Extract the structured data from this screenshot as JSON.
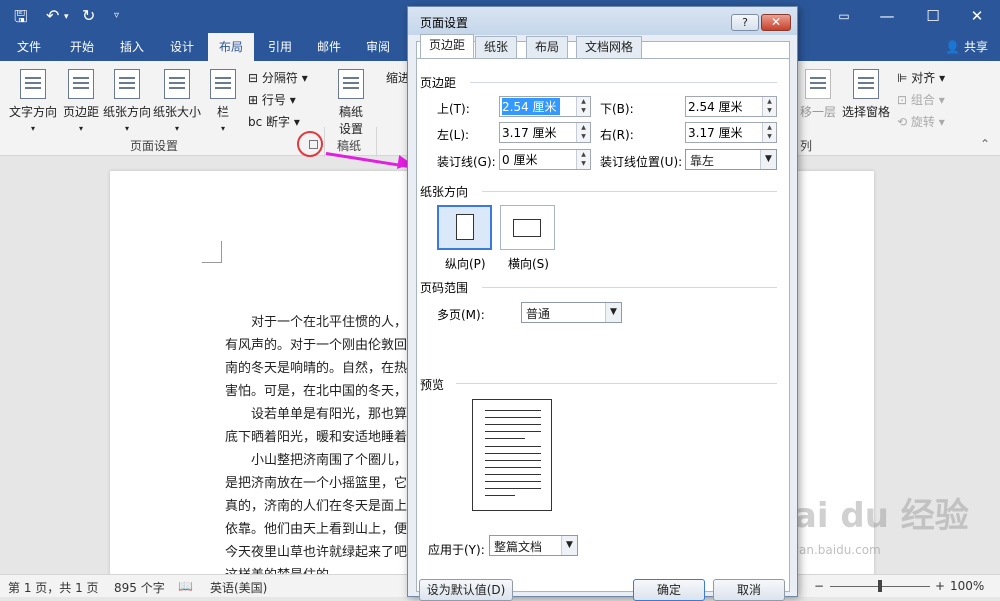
{
  "titlebar": {
    "save_icon": "save-icon",
    "undo_icon": "undo-icon",
    "redo_icon": "redo-icon",
    "customize_icon": "chevron-down-icon",
    "ribbon_display_icon": "ribbon-display-icon",
    "minimize": "—",
    "maximize": "☐",
    "close": "✕",
    "bg_color": "#2b579a"
  },
  "ribbon_tabs": [
    "文件",
    "开始",
    "插入",
    "设计",
    "布局",
    "引用",
    "邮件",
    "审阅"
  ],
  "ribbon_active_tab": "布局",
  "share_label": "共享",
  "ribbon": {
    "text_direction": "文字方向",
    "margins": "页边距",
    "orientation": "纸张方向",
    "size": "纸张大小",
    "columns": "栏",
    "breaks": "分隔符",
    "line_numbers": "行号",
    "hyphenation": "断字",
    "page_setup_group": "页面设置",
    "draft_paper": "稿纸\n设置",
    "draft_line1": "稿纸",
    "draft_line2": "设置",
    "draft_group": "稿纸",
    "indent": "缩进",
    "backward": "移一层",
    "selection_pane": "选择窗格",
    "align": "对齐",
    "group": "组合",
    "rotate": "旋转",
    "arrange_group_partial": "列"
  },
  "document": {
    "lines": [
      "　　对于一个在北平住惯的人，",
      "有风声的。对于一个刚由伦敦回",
      "南的冬天是响晴的。自然，在热",
      "害怕。可是，在北中国的冬天，",
      "　　设若单单是有阳光，那也算",
      "底下晒着阳光，暖和安适地睡着",
      "　　小山整把济南围了个圈儿，",
      "是把济南放在一个小摇篮里，它",
      "真的，济南的人们在冬天是面上",
      "依靠。他们由天上看到山上，便",
      "今天夜里山草也许就绿起来了吧",
      "这样美的梦是住的"
    ]
  },
  "statusbar": {
    "page": "第 1 页，共 1 页",
    "words": "895 个字",
    "lang": "英语(美国)",
    "zoom": "100%",
    "zoom_minus": "−",
    "zoom_plus": "+"
  },
  "dialog": {
    "title": "页面设置",
    "help": "?",
    "close": "✕",
    "tabs": [
      "页边距",
      "纸张",
      "布局",
      "文档网格"
    ],
    "active_tab": "页边距",
    "margins_section": "页边距",
    "top_label": "上(T):",
    "top_value": "2.54 厘米",
    "bottom_label": "下(B):",
    "bottom_value": "2.54 厘米",
    "left_label": "左(L):",
    "left_value": "3.17 厘米",
    "right_label": "右(R):",
    "right_value": "3.17 厘米",
    "gutter_label": "装订线(G):",
    "gutter_value": "0 厘米",
    "gutter_pos_label": "装订线位置(U):",
    "gutter_pos_value": "靠左",
    "orientation_section": "纸张方向",
    "portrait": "纵向(P)",
    "landscape": "横向(S)",
    "pages_section": "页码范围",
    "multiple_label": "多页(M):",
    "multiple_value": "普通",
    "preview_section": "预览",
    "apply_label": "应用于(Y):",
    "apply_value": "整篇文档",
    "default_btn": "设为默认值(D)",
    "ok_btn": "确定",
    "cancel_btn": "取消"
  },
  "watermark": {
    "main": "Bai du 经验",
    "sub": "jingyan.baidu.com"
  },
  "colors": {
    "accent": "#2b579a",
    "highlight_circle": "#e0393e",
    "arrow": "#e21fe0",
    "selection": "#3399ff"
  }
}
